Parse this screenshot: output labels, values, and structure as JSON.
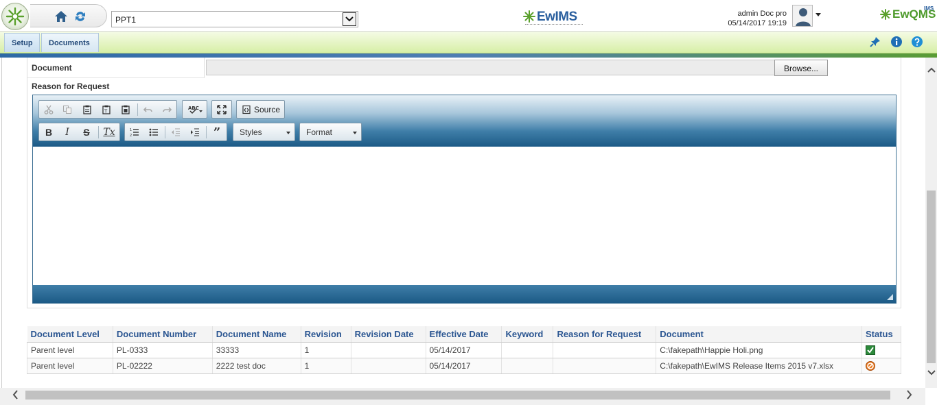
{
  "header": {
    "project_selector": {
      "value": "PPT1"
    },
    "app_logo_text": "EwIMS",
    "right_logo_text": "EwQMS",
    "right_logo_super": "IMS",
    "user": {
      "name": "admin Doc pro",
      "datetime": "05/14/2017 19:19"
    }
  },
  "menu": {
    "tabs": [
      {
        "label": "Setup"
      },
      {
        "label": "Documents"
      }
    ]
  },
  "form": {
    "document_label": "Document",
    "browse_label": "Browse...",
    "reason_label": "Reason for Request",
    "editor": {
      "source_label": "Source",
      "styles_label": "Styles",
      "format_label": "Format"
    }
  },
  "table": {
    "columns": [
      "Document Level",
      "Document Number",
      "Document Name",
      "Revision",
      "Revision Date",
      "Effective Date",
      "Keyword",
      "Reason for Request",
      "Document",
      "Status"
    ],
    "rows": [
      {
        "level": "Parent level",
        "number": "PL-0333",
        "name": "33333",
        "revision": "1",
        "revision_date": "",
        "effective_date": "05/14/2017",
        "keyword": "",
        "reason": "",
        "document": "C:\\fakepath\\Happie Holi.png",
        "status": "approved-icon"
      },
      {
        "level": "Parent level",
        "number": "PL-02222",
        "name": "2222 test doc",
        "revision": "1",
        "revision_date": "",
        "effective_date": "05/14/2017",
        "keyword": "",
        "reason": "",
        "document": "C:\\fakepath\\EwIMS Release Items 2015 v7.xlsx",
        "status": "rejected-icon"
      }
    ]
  },
  "colors": {
    "menu_bar": "#d7efa6",
    "header_text_blue": "#2a5591",
    "editor_toolbar": "#1c5a86"
  }
}
